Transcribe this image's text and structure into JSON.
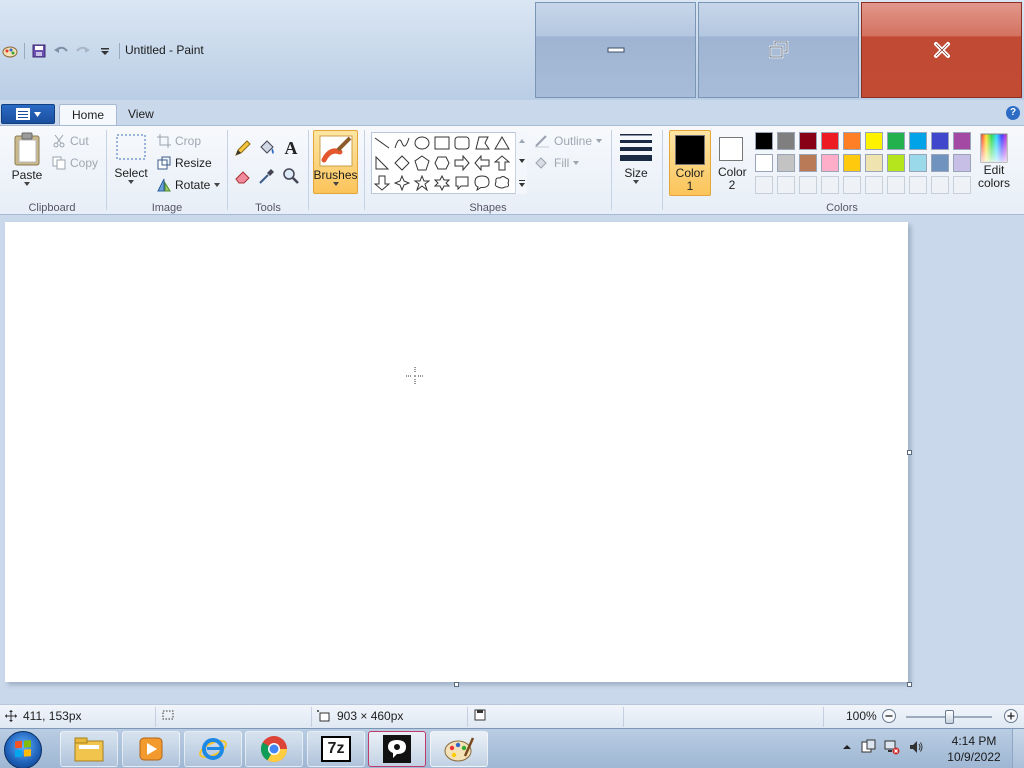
{
  "window": {
    "title": "Untitled - Paint"
  },
  "caption": {
    "minimize": "minimize",
    "restore": "restore",
    "close": "close"
  },
  "tabs": {
    "home": "Home",
    "view": "View"
  },
  "clipboard": {
    "paste": "Paste",
    "cut": "Cut",
    "copy": "Copy",
    "label": "Clipboard"
  },
  "image": {
    "select": "Select",
    "crop": "Crop",
    "resize": "Resize",
    "rotate": "Rotate",
    "label": "Image"
  },
  "tools": {
    "label": "Tools",
    "items": [
      "pencil-icon",
      "fill-bucket-icon",
      "text-icon",
      "eraser-icon",
      "color-picker-icon",
      "magnifier-icon"
    ]
  },
  "brushes": {
    "label": "Brushes"
  },
  "shapes": {
    "label": "Shapes",
    "outline": "Outline",
    "fill": "Fill"
  },
  "size": {
    "label": "Size"
  },
  "colors": {
    "label": "Colors",
    "color1_label": "Color 1",
    "color2_label": "Color 2",
    "edit_label": "Edit colors",
    "color1_value": "#000000",
    "color2_value": "#ffffff",
    "row1": [
      "#000000",
      "#7f7f7f",
      "#880015",
      "#ed1c24",
      "#ff7f27",
      "#fff200",
      "#22b14c",
      "#00a2e8",
      "#3f48cc",
      "#a349a4"
    ],
    "row2": [
      "#ffffff",
      "#c3c3c3",
      "#b97a57",
      "#ffaec9",
      "#ffc90e",
      "#efe4b0",
      "#b5e61d",
      "#99d9ea",
      "#7092be",
      "#c8bfe7"
    ]
  },
  "status": {
    "cursor_pos": "411, 153px",
    "canvas_size": "903 × 460px",
    "zoom": "100%",
    "zoom_fraction": 0.5
  },
  "taskbar": {
    "time": "4:14 PM",
    "date": "10/9/2022",
    "apps": [
      "file-explorer-icon",
      "media-player-icon",
      "internet-explorer-icon",
      "chrome-icon",
      "7zip-icon",
      "chat-app-icon",
      "paint-icon"
    ],
    "sevenzip_text": "7z"
  }
}
